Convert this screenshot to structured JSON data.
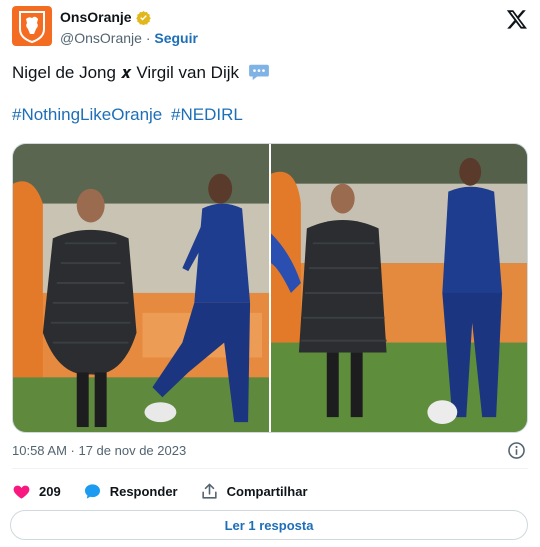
{
  "header": {
    "display_name": "OnsOranje",
    "handle": "@OnsOranje",
    "separator": "·",
    "follow_label": "Seguir",
    "avatar_icon": "knvb-lion-logo",
    "verified_icon": "gold-verified-badge",
    "platform_icon": "x-logo"
  },
  "tweet": {
    "line1": "Nigel de Jong 𝒙 Virgil van Dijk",
    "line1_emoji": "speech-bubble-icon",
    "hashtags": [
      "#NothingLikeOranje",
      "#NEDIRL"
    ]
  },
  "media": {
    "photos": [
      {
        "description_icon": "photo-1"
      },
      {
        "description_icon": "photo-2"
      }
    ]
  },
  "meta": {
    "timestamp": "10:58 AM · 17 de nov de 2023"
  },
  "actions": {
    "like_count": "209",
    "reply_label": "Responder",
    "share_label": "Compartilhar"
  },
  "read_replies_label": "Ler 1 resposta",
  "colors": {
    "accent": "#1d6fb8",
    "like": "#f91880",
    "reply": "#1d9bf0",
    "brand_orange": "#f36c21"
  }
}
